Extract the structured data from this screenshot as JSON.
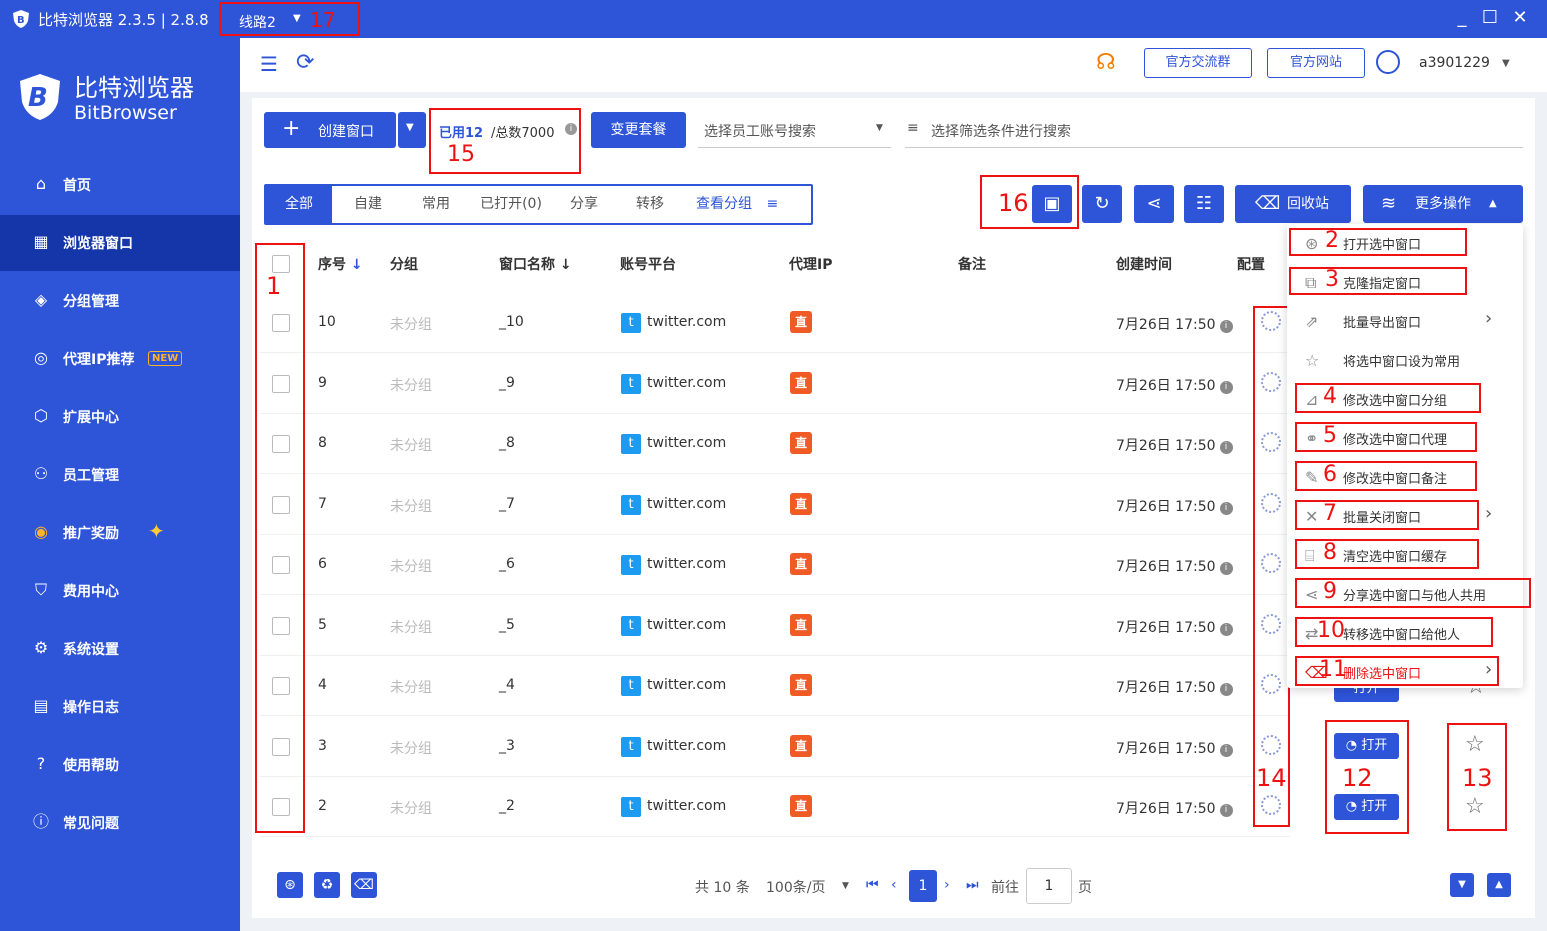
{
  "window": {
    "title": "比特浏览器 2.3.5 | 2.8.8",
    "route_label": "线路2",
    "route_annotation": "17"
  },
  "brand": {
    "name_cn": "比特浏览器",
    "name_en": "BitBrowser"
  },
  "sidebar": {
    "items": [
      {
        "label": "首页",
        "icon": "home-icon"
      },
      {
        "label": "浏览器窗口",
        "icon": "grid-icon",
        "active": true
      },
      {
        "label": "分组管理",
        "icon": "layers-icon"
      },
      {
        "label": "代理IP推荐",
        "icon": "location-icon",
        "badge": "NEW"
      },
      {
        "label": "扩展中心",
        "icon": "cube-icon"
      },
      {
        "label": "员工管理",
        "icon": "users-icon"
      },
      {
        "label": "推广奖励",
        "icon": "gift-icon"
      },
      {
        "label": "费用中心",
        "icon": "shield-icon"
      },
      {
        "label": "系统设置",
        "icon": "gear-icon"
      },
      {
        "label": "操作日志",
        "icon": "log-icon"
      },
      {
        "label": "使用帮助",
        "icon": "help-icon"
      },
      {
        "label": "常见问题",
        "icon": "info-icon"
      }
    ]
  },
  "header": {
    "group_chat": "官方交流群",
    "website": "官方网站",
    "username": "a3901229"
  },
  "toolbar": {
    "create_label": "创建窗口",
    "used": "已用12",
    "total": "/总数7000",
    "usage_annotation": "15",
    "change_plan": "变更套餐",
    "employee_search_placeholder": "选择员工账号搜索",
    "filter_placeholder": "选择筛选条件进行搜索",
    "recycle_label": "回收站",
    "more_label": "更多操作",
    "save_annotation": "16"
  },
  "tabs": [
    "全部",
    "自建",
    "常用",
    "已打开(0)",
    "分享",
    "转移",
    "查看分组"
  ],
  "table": {
    "headers": [
      "序号",
      "分组",
      "窗口名称",
      "账号平台",
      "代理IP",
      "备注",
      "创建时间",
      "配置"
    ],
    "rows": [
      {
        "seq": "10",
        "group": "未分组",
        "name": "_10",
        "platform": "twitter.com",
        "proxy": "直",
        "created": "7月26日 17:50"
      },
      {
        "seq": "9",
        "group": "未分组",
        "name": "_9",
        "platform": "twitter.com",
        "proxy": "直",
        "created": "7月26日 17:50"
      },
      {
        "seq": "8",
        "group": "未分组",
        "name": "_8",
        "platform": "twitter.com",
        "proxy": "直",
        "created": "7月26日 17:50"
      },
      {
        "seq": "7",
        "group": "未分组",
        "name": "_7",
        "platform": "twitter.com",
        "proxy": "直",
        "created": "7月26日 17:50"
      },
      {
        "seq": "6",
        "group": "未分组",
        "name": "_6",
        "platform": "twitter.com",
        "proxy": "直",
        "created": "7月26日 17:50"
      },
      {
        "seq": "5",
        "group": "未分组",
        "name": "_5",
        "platform": "twitter.com",
        "proxy": "直",
        "created": "7月26日 17:50"
      },
      {
        "seq": "4",
        "group": "未分组",
        "name": "_4",
        "platform": "twitter.com",
        "proxy": "直",
        "created": "7月26日 17:50"
      },
      {
        "seq": "3",
        "group": "未分组",
        "name": "_3",
        "platform": "twitter.com",
        "proxy": "直",
        "created": "7月26日 17:50"
      },
      {
        "seq": "2",
        "group": "未分组",
        "name": "_2",
        "platform": "twitter.com",
        "proxy": "直",
        "created": "7月26日 17:50"
      }
    ],
    "open_label": "打开"
  },
  "annotations": {
    "checkbox_col": "1",
    "config_col": "14",
    "open_col": "12",
    "star_col": "13"
  },
  "menu": {
    "items": [
      {
        "num": "2",
        "label": "打开选中窗口"
      },
      {
        "num": "3",
        "label": "克隆指定窗口"
      },
      {
        "num": "",
        "label": "批量导出窗口"
      },
      {
        "num": "",
        "label": "将选中窗口设为常用"
      },
      {
        "num": "4",
        "label": "修改选中窗口分组"
      },
      {
        "num": "5",
        "label": "修改选中窗口代理"
      },
      {
        "num": "6",
        "label": "修改选中窗口备注"
      },
      {
        "num": "7",
        "label": "批量关闭窗口"
      },
      {
        "num": "8",
        "label": "清空选中窗口缓存"
      },
      {
        "num": "9",
        "label": "分享选中窗口与他人共用"
      },
      {
        "num": "10",
        "label": "转移选中窗口给他人"
      },
      {
        "num": "11",
        "label": "删除选中窗口"
      }
    ]
  },
  "pagination": {
    "total": "共 10 条",
    "page_size": "100条/页",
    "current_page": "1",
    "goto_label": "前往",
    "goto_value": "1",
    "page_suffix": "页"
  },
  "colors": {
    "primary": "#2e54d8",
    "sidebar_active": "#1436a8",
    "annotation": "#ee1111",
    "proxy_badge": "#f05a24"
  }
}
